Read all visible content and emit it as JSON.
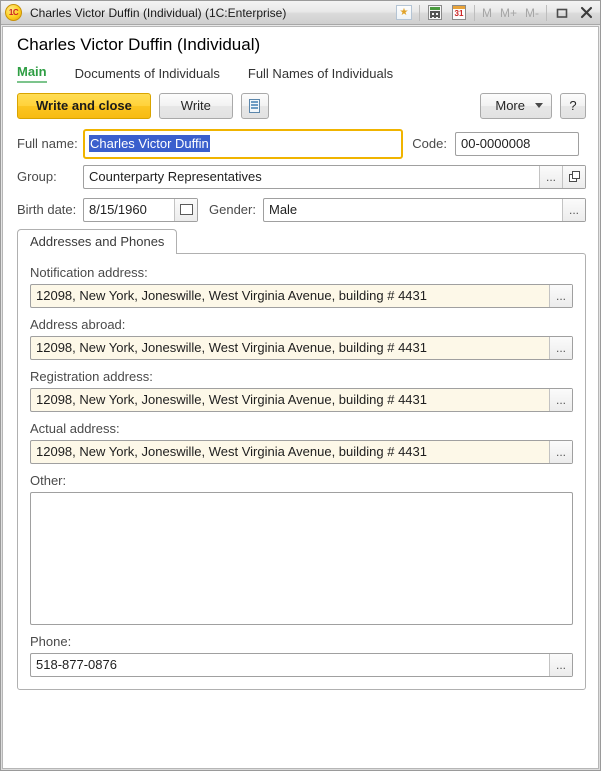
{
  "window": {
    "title": "Charles Victor Duffin (Individual)  (1C:Enterprise)",
    "app_icon": "1c-logo-icon",
    "titlebar_tools": [
      {
        "name": "favorites-icon",
        "label": "★"
      },
      {
        "name": "calculator-icon",
        "label": ""
      },
      {
        "name": "calendar-icon",
        "label": "31"
      }
    ],
    "memory_buttons": [
      "M",
      "M+",
      "M-"
    ],
    "maximize_label": "❐",
    "close_label": "✕"
  },
  "page": {
    "title": "Charles Victor Duffin (Individual)"
  },
  "navtabs": [
    {
      "label": "Main",
      "active": true
    },
    {
      "label": "Documents of Individuals",
      "active": false
    },
    {
      "label": "Full Names of Individuals",
      "active": false
    }
  ],
  "commandbar": {
    "write_and_close": "Write and close",
    "write": "Write",
    "list_icon": "list-icon",
    "more": "More",
    "help": "?"
  },
  "form": {
    "full_name": {
      "label": "Full name:",
      "value": "Charles Victor Duffin",
      "selected": true,
      "focused": true
    },
    "code": {
      "label": "Code:",
      "value": "00-0000008"
    },
    "group": {
      "label": "Group:",
      "value": "Counterparty Representatives",
      "choose_label": "...",
      "open_icon": "open-icon"
    },
    "birth_date": {
      "label": "Birth date:",
      "value": "8/15/1960",
      "calendar_icon": "calendar-picker-icon"
    },
    "gender": {
      "label": "Gender:",
      "value": "Male",
      "choose_label": "..."
    }
  },
  "panel": {
    "tab_label": "Addresses and Phones",
    "fields": [
      {
        "name": "notification-address",
        "label": "Notification address:",
        "value": "12098, New York, Joneswille, West Virginia Avenue, building # 4431",
        "cream": true,
        "choose_label": "..."
      },
      {
        "name": "address-abroad",
        "label": "Address abroad:",
        "value": "12098, New York, Joneswille, West Virginia Avenue, building # 4431",
        "cream": true,
        "choose_label": "..."
      },
      {
        "name": "registration-address",
        "label": "Registration address:",
        "value": "12098, New York, Joneswille, West Virginia Avenue, building # 4431",
        "cream": true,
        "choose_label": "..."
      },
      {
        "name": "actual-address",
        "label": "Actual address:",
        "value": "12098, New York, Joneswille, West Virginia Avenue, building # 4431",
        "cream": true,
        "choose_label": "..."
      }
    ],
    "other": {
      "label": "Other:",
      "value": ""
    },
    "phone": {
      "label": "Phone:",
      "value": "518-877-0876",
      "choose_label": "..."
    }
  },
  "colors": {
    "accent_yellow": "#ffd23a",
    "focus_ring": "#f0b400",
    "active_tab_green": "#2f9e44",
    "selection_blue": "#3a5fcd",
    "cream_field": "#fdf8e8"
  }
}
